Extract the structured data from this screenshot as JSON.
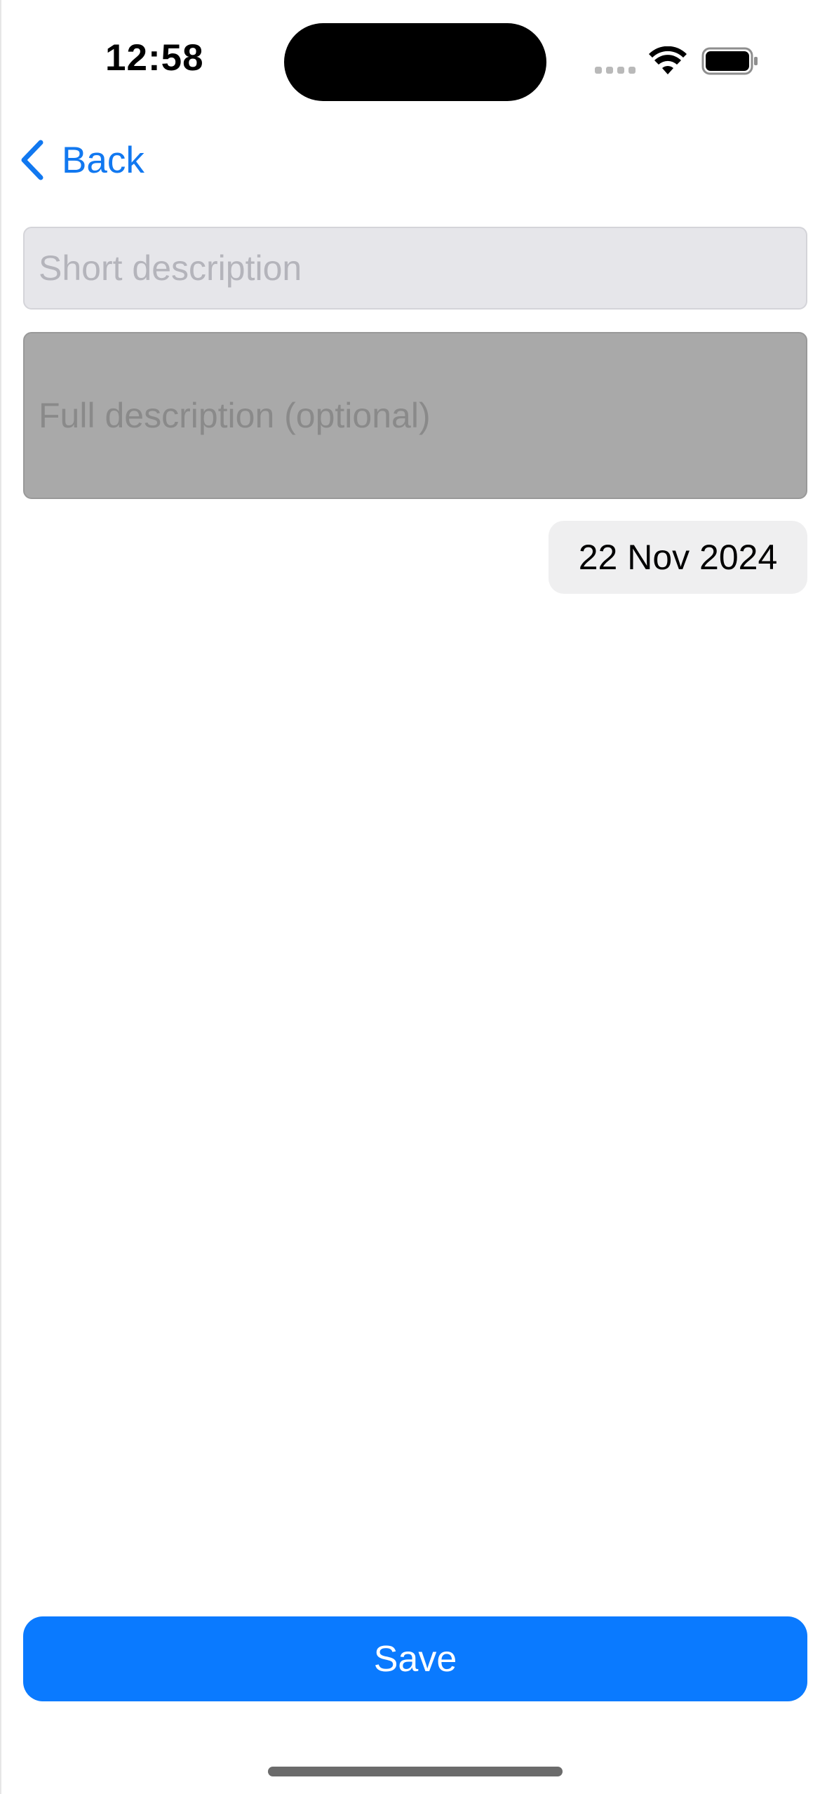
{
  "status_bar": {
    "time": "12:58"
  },
  "nav": {
    "back_label": "Back",
    "accent_color": "#1178F0"
  },
  "form": {
    "short_description": {
      "value": "",
      "placeholder": "Short description"
    },
    "full_description": {
      "value": "",
      "placeholder": "Full description (optional)"
    },
    "date": "22 Nov 2024"
  },
  "actions": {
    "save_label": "Save",
    "save_color": "#0A7AFF"
  },
  "icons": {
    "back": "chevron-left-icon",
    "wifi": "wifi-icon",
    "battery": "battery-icon",
    "signal": "cellular-signal-icon"
  }
}
